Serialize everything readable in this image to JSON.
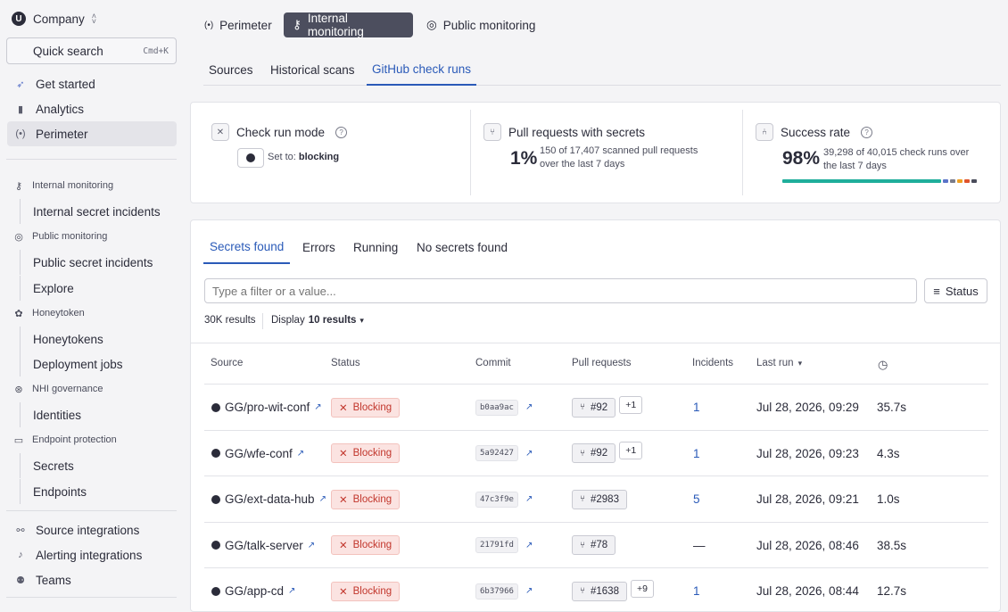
{
  "sidebar": {
    "company": "Company",
    "search_label": "Quick search",
    "search_shortcut": "Cmd+K",
    "top_items": [
      "Get started",
      "Analytics",
      "Perimeter"
    ],
    "internal_monitoring": "Internal monitoring",
    "internal_secret_incidents": "Internal secret incidents",
    "public_monitoring": "Public monitoring",
    "public_secret_incidents": "Public secret incidents",
    "explore": "Explore",
    "honeytoken": "Honeytoken",
    "honeytokens": "Honeytokens",
    "deployment_jobs": "Deployment jobs",
    "nhi_governance": "NHI governance",
    "identities": "Identities",
    "endpoint_protection": "Endpoint protection",
    "secrets": "Secrets",
    "endpoints": "Endpoints",
    "bottom_items": [
      "Source integrations",
      "Alerting integrations",
      "Teams"
    ]
  },
  "top_tabs": [
    "Perimeter",
    "Internal monitoring",
    "Public monitoring"
  ],
  "sub_tabs": [
    "Sources",
    "Historical scans",
    "GitHub check runs"
  ],
  "stats": {
    "mode_title": "Check run mode",
    "set_to_label": "Set to:",
    "set_to_value": "blocking",
    "pr_title": "Pull requests with secrets",
    "pr_value": "1%",
    "pr_note_1": "150 of 17,407 scanned pull requests",
    "pr_note_2": "over the last 7 days",
    "success_title": "Success rate",
    "success_value": "98%",
    "success_note_1": "39,298 of 40,015 check runs over",
    "success_note_2": "the last 7 days",
    "colors": [
      "#1fae9b",
      "#5b74c9",
      "#7a7c8a",
      "#f0a020",
      "#e0542c",
      "#4a4c5b"
    ]
  },
  "result_tabs": [
    "Secrets found",
    "Errors",
    "Running",
    "No secrets found"
  ],
  "filter_placeholder": "Type a filter or a value...",
  "status_button": "Status",
  "results_count": "30K results",
  "display_label": "Display",
  "display_value": "10 results",
  "columns": [
    "Source",
    "Status",
    "Commit",
    "Pull requests",
    "Incidents",
    "Last run"
  ],
  "rows": [
    {
      "source": "GG/pro-wit-conf",
      "status": "Blocking",
      "commit": "b0aa9ac",
      "pr": "#92",
      "pr_extra": "+1",
      "incidents": "1",
      "last_run": "Jul 28, 2026, 09:29",
      "duration": "35.7s"
    },
    {
      "source": "GG/wfe-conf",
      "status": "Blocking",
      "commit": "5a92427",
      "pr": "#92",
      "pr_extra": "+1",
      "incidents": "1",
      "last_run": "Jul 28, 2026, 09:23",
      "duration": "4.3s"
    },
    {
      "source": "GG/ext-data-hub",
      "status": "Blocking",
      "commit": "47c3f9e",
      "pr": "#2983",
      "pr_extra": "",
      "incidents": "5",
      "last_run": "Jul 28, 2026, 09:21",
      "duration": "1.0s"
    },
    {
      "source": "GG/talk-server",
      "status": "Blocking",
      "commit": "21791fd",
      "pr": "#78",
      "pr_extra": "",
      "incidents": "—",
      "last_run": "Jul 28, 2026, 08:46",
      "duration": "38.5s"
    },
    {
      "source": "GG/app-cd",
      "status": "Blocking",
      "commit": "6b37966",
      "pr": "#1638",
      "pr_extra": "+9",
      "incidents": "1",
      "last_run": "Jul 28, 2026, 08:44",
      "duration": "12.7s"
    }
  ]
}
